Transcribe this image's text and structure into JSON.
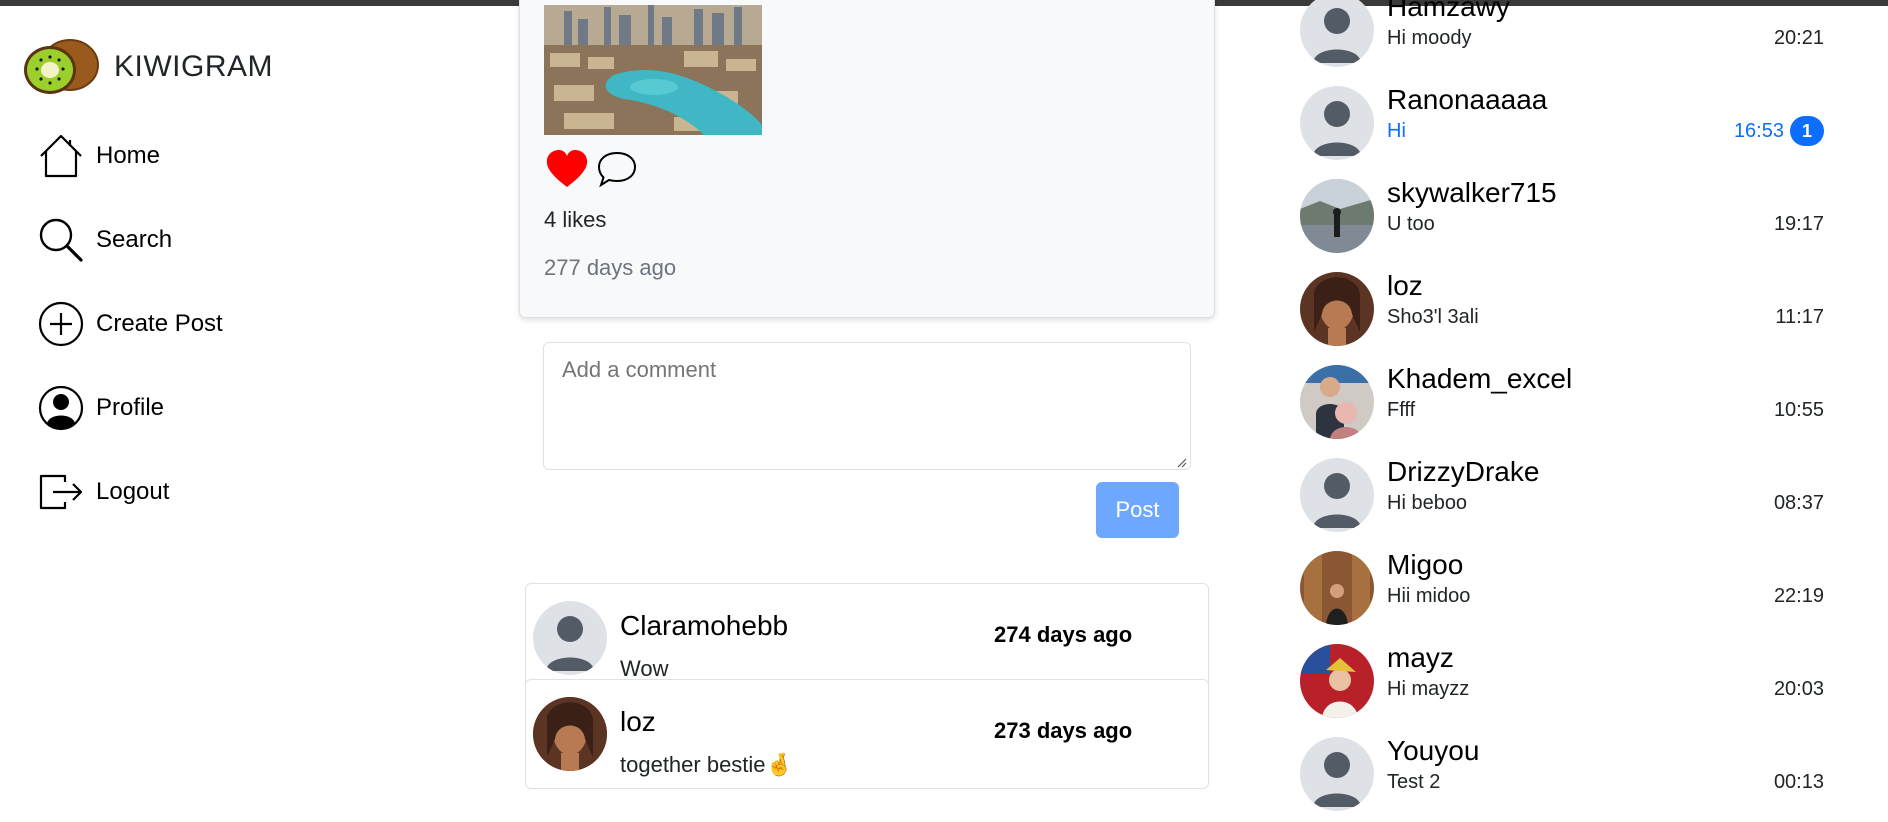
{
  "brand": {
    "name": "KIWIGRAM"
  },
  "nav": [
    {
      "label": "Home",
      "icon": "home-icon"
    },
    {
      "label": "Search",
      "icon": "search-icon"
    },
    {
      "label": "Create Post",
      "icon": "plus-circle-icon"
    },
    {
      "label": "Profile",
      "icon": "user-circle-icon"
    },
    {
      "label": "Logout",
      "icon": "logout-icon"
    }
  ],
  "post": {
    "likes": "4 likes",
    "time": "277 days ago",
    "liked": true,
    "like_color": "#ff0000"
  },
  "comment_form": {
    "placeholder": "Add a comment",
    "post_label": "Post"
  },
  "comments": [
    {
      "user": "Claramohebb",
      "text": "Wow",
      "time": "274 days ago",
      "avatar": "default"
    },
    {
      "user": "loz",
      "text": "together bestie🤞",
      "time": "273 days ago",
      "avatar": "photo"
    }
  ],
  "chats": [
    {
      "name": "Hamzawy",
      "message": "Hi moody",
      "time": "20:21",
      "avatar": "default"
    },
    {
      "name": "Ranonaaaaa",
      "message": "Hi",
      "time": "16:53",
      "unread": "1",
      "avatar": "default"
    },
    {
      "name": "skywalker715",
      "message": "U too",
      "time": "19:17",
      "avatar": "photo"
    },
    {
      "name": "loz",
      "message": "Sho3'l 3ali",
      "time": "11:17",
      "avatar": "photo"
    },
    {
      "name": "Khadem_excel",
      "message": "Ffff",
      "time": "10:55",
      "avatar": "photo"
    },
    {
      "name": "DrizzyDrake",
      "message": "Hi beboo",
      "time": "08:37",
      "avatar": "default"
    },
    {
      "name": "Migoo",
      "message": "Hii midoo",
      "time": "22:19",
      "avatar": "photo"
    },
    {
      "name": "mayz",
      "message": "Hi mayzz",
      "time": "20:03",
      "avatar": "photo"
    },
    {
      "name": "Youyou",
      "message": "Test 2",
      "time": "00:13",
      "avatar": "default"
    }
  ],
  "colors": {
    "accent": "#0d6efd",
    "post_button": "#6ea8fe",
    "muted": "#6c757d"
  }
}
